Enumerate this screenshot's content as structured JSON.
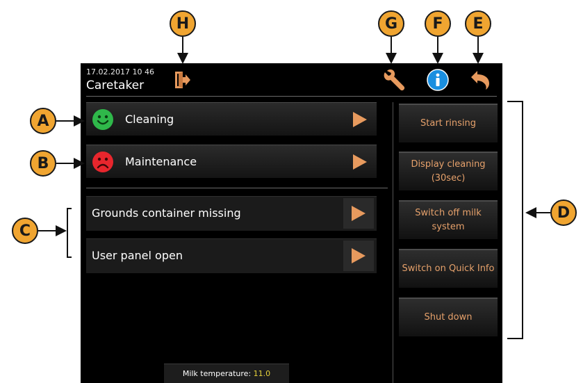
{
  "header": {
    "datetime": "17.02.2017 10 46",
    "user": "Caretaker",
    "icons": [
      "logout-door-icon",
      "wrench-icon",
      "info-icon",
      "back-arrow-icon"
    ]
  },
  "status_rows": [
    {
      "label": "Cleaning",
      "status": "ok",
      "status_color": "#2fb84a"
    },
    {
      "label": "Maintenance",
      "status": "alert",
      "status_color": "#e8262d"
    }
  ],
  "warnings": [
    {
      "label": "Grounds container missing"
    },
    {
      "label": "User panel open"
    }
  ],
  "side_buttons": [
    {
      "label": "Start rinsing"
    },
    {
      "label": "Display cleaning (30sec)"
    },
    {
      "label": "Switch off milk system"
    },
    {
      "label": "Switch on Quick Info"
    },
    {
      "label": "Shut down"
    }
  ],
  "footer": {
    "milk_label": "Milk temperature: ",
    "milk_value": "11.0"
  },
  "callouts": {
    "a": "A",
    "b": "B",
    "c": "C",
    "d": "D",
    "e": "E",
    "f": "F",
    "g": "G",
    "h": "H"
  },
  "colors": {
    "accent_orange": "#e79a5e",
    "callout_fill": "#f0a531",
    "info_blue": "#1a8fe0",
    "milk_value": "#e8d33b"
  }
}
